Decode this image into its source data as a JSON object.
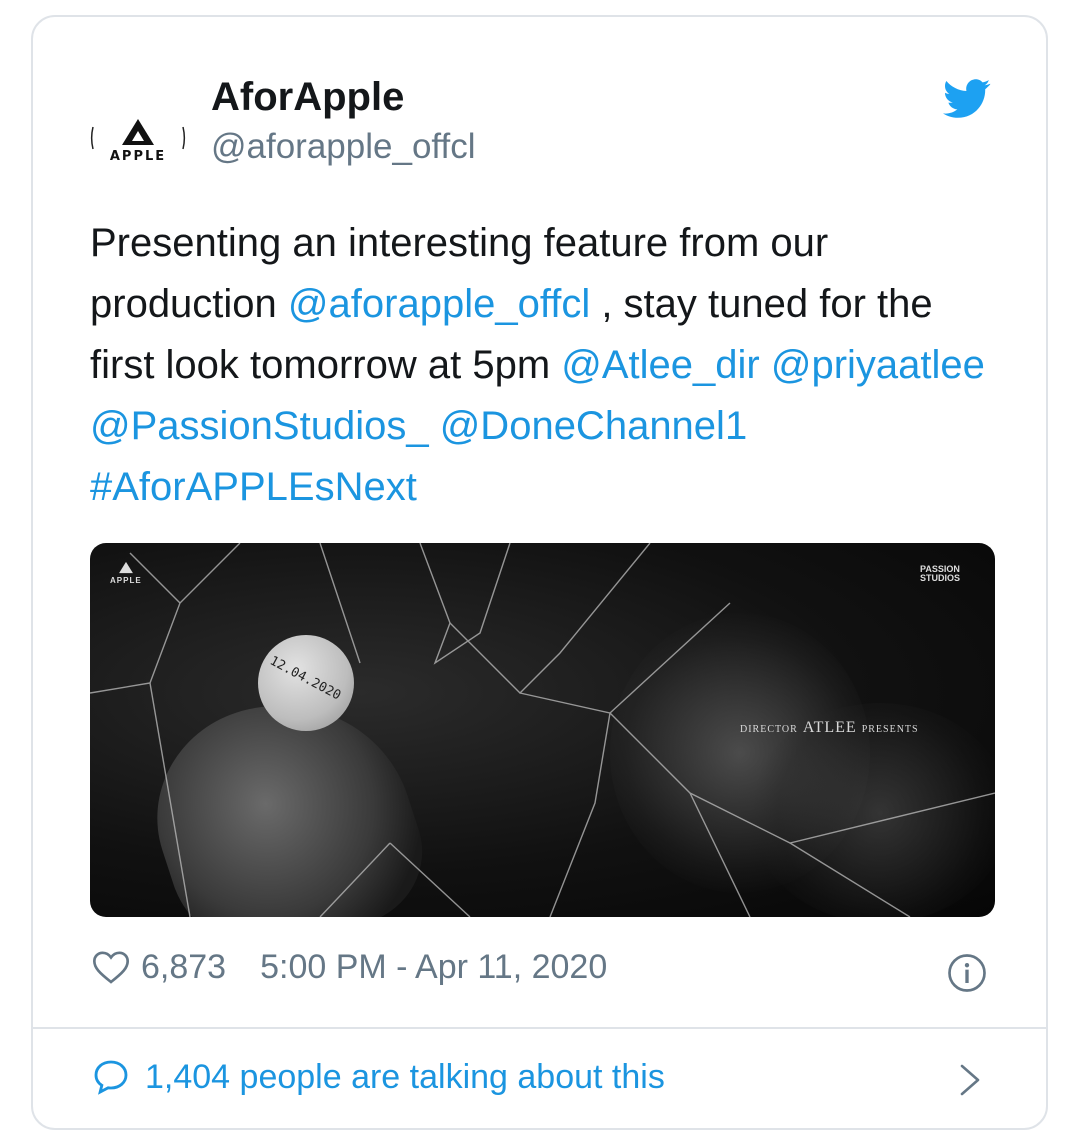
{
  "author": {
    "name": "AforApple",
    "handle": "@aforapple_offcl",
    "avatar_word": "APPLE"
  },
  "tweet": {
    "segments": [
      {
        "text": "Presenting an interesting feature from our production ",
        "type": "text"
      },
      {
        "text": "@aforapple_offcl",
        "type": "link"
      },
      {
        "text": " , stay tuned for the first look tomorrow at 5pm ",
        "type": "text"
      },
      {
        "text": "@Atlee_dir",
        "type": "link"
      },
      {
        "text": " ",
        "type": "text"
      },
      {
        "text": "@priyaatlee",
        "type": "link"
      },
      {
        "text": " ",
        "type": "text"
      },
      {
        "text": "@PassionStudios_",
        "type": "link"
      },
      {
        "text": " ",
        "type": "text"
      },
      {
        "text": "@DoneChannel1",
        "type": "link"
      },
      {
        "text": " ",
        "type": "text"
      },
      {
        "text": "#AforAPPLEsNext",
        "type": "link"
      }
    ]
  },
  "media": {
    "logo_left": "APPLE",
    "logo_right_line1": "PASSION",
    "logo_right_line2": "STUDIOS",
    "coin_date": "12.04.2020",
    "credit_prefix": "DIRECTOR",
    "credit_name": "ATLEE",
    "credit_suffix": "PRESENTS"
  },
  "stats": {
    "likes": "6,873",
    "timestamp": "5:00 PM - Apr 11, 2020"
  },
  "footer": {
    "talking": "1,404 people are talking about this"
  },
  "icons": {
    "brand": "twitter-bird-icon",
    "like": "heart-icon",
    "info": "info-icon",
    "reply": "speech-bubble-icon",
    "chevron": "chevron-right-icon"
  },
  "colors": {
    "link": "#1b95e0",
    "secondary": "#657786",
    "twitter_blue": "#1da1f2",
    "border": "#dfe3e8"
  }
}
